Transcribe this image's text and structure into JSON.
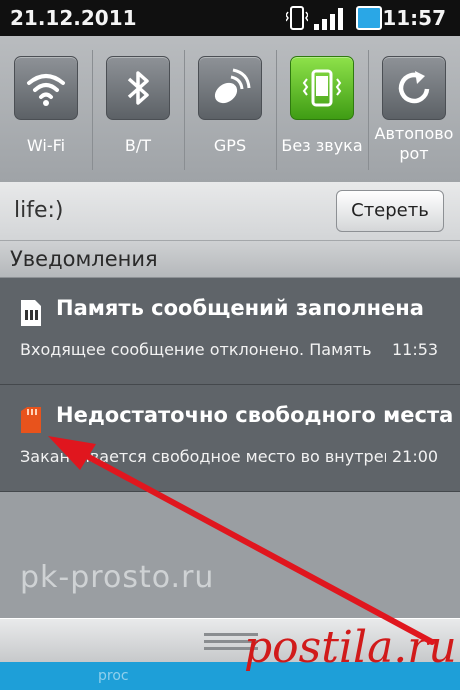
{
  "status_bar": {
    "date": "21.12.2011",
    "time": "11:57"
  },
  "toggles": [
    {
      "label": "Wi-Fi",
      "icon": "wifi-icon",
      "active": false
    },
    {
      "label": "B/T",
      "icon": "bluetooth-icon",
      "active": false
    },
    {
      "label": "GPS",
      "icon": "gps-icon",
      "active": false
    },
    {
      "label": "Без звука",
      "icon": "vibrate-phone-icon",
      "active": true
    },
    {
      "label": "Автоповорот",
      "label_line1": "Автопово",
      "label_line2": "рот",
      "icon": "rotate-icon",
      "active": false
    }
  ],
  "operator": {
    "name": "life:)",
    "clear_label": "Стереть"
  },
  "notifications": {
    "header": "Уведомления",
    "items": [
      {
        "title": "Память сообщений заполнена",
        "text": "Входящее сообщение отклонено. Память",
        "time": "11:53",
        "icon": "sim-card-icon"
      },
      {
        "title": "Недостаточно свободного места",
        "text": "Заканчивается свободное место во внутренней",
        "time": "21:00",
        "icon": "sd-card-icon"
      }
    ]
  },
  "watermark": "pk-prosto.ru",
  "brand": "postila.ru",
  "bottom_text": "proc",
  "colors": {
    "active_toggle": "#4caf1e",
    "arrow": "#e0161e",
    "bottom_strip": "#1e9fd8"
  }
}
